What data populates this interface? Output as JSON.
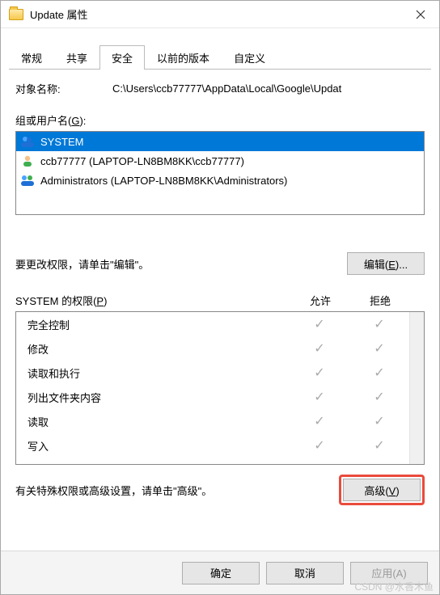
{
  "titlebar": {
    "title": "Update 属性"
  },
  "tabs": {
    "general": "常规",
    "share": "共享",
    "security": "安全",
    "previous": "以前的版本",
    "custom": "自定义"
  },
  "object": {
    "label": "对象名称:",
    "path": "C:\\Users\\ccb77777\\AppData\\Local\\Google\\Updat"
  },
  "groups": {
    "label_pre": "组或用户名(",
    "label_key": "G",
    "label_post": "):",
    "items": [
      {
        "name": "SYSTEM",
        "icon": "users-blue",
        "selected": true
      },
      {
        "name": "ccb77777 (LAPTOP-LN8BM8KK\\ccb77777)",
        "icon": "user-green",
        "selected": false
      },
      {
        "name": "Administrators (LAPTOP-LN8BM8KK\\Administrators)",
        "icon": "users-mixed",
        "selected": false
      }
    ]
  },
  "edit": {
    "text": "要更改权限，请单击\"编辑\"。",
    "button_pre": "编辑(",
    "button_key": "E",
    "button_post": ")..."
  },
  "permissions": {
    "header_pre": "SYSTEM 的权限(",
    "header_key": "P",
    "header_post": ")",
    "allow": "允许",
    "deny": "拒绝",
    "rows": [
      {
        "name": "完全控制",
        "allow": true,
        "deny": true
      },
      {
        "name": "修改",
        "allow": true,
        "deny": true
      },
      {
        "name": "读取和执行",
        "allow": true,
        "deny": true
      },
      {
        "name": "列出文件夹内容",
        "allow": true,
        "deny": true
      },
      {
        "name": "读取",
        "allow": true,
        "deny": true
      },
      {
        "name": "写入",
        "allow": true,
        "deny": true
      }
    ]
  },
  "advanced": {
    "text": "有关特殊权限或高级设置，请单击\"高级\"。",
    "button_pre": "高级(",
    "button_key": "V",
    "button_post": ")"
  },
  "buttons": {
    "ok": "确定",
    "cancel": "取消",
    "apply_pre": "应用(",
    "apply_key": "A",
    "apply_post": ")"
  },
  "watermark": "CSDN @水香木鱼"
}
